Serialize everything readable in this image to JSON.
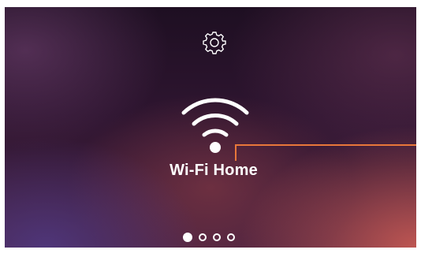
{
  "screen": {
    "settings_icon": "gear-icon",
    "wifi_icon": "wifi-icon",
    "network_name": "Wi-Fi Home",
    "accent_color": "#e8773a",
    "pager": {
      "count": 4,
      "active_index": 0
    }
  }
}
